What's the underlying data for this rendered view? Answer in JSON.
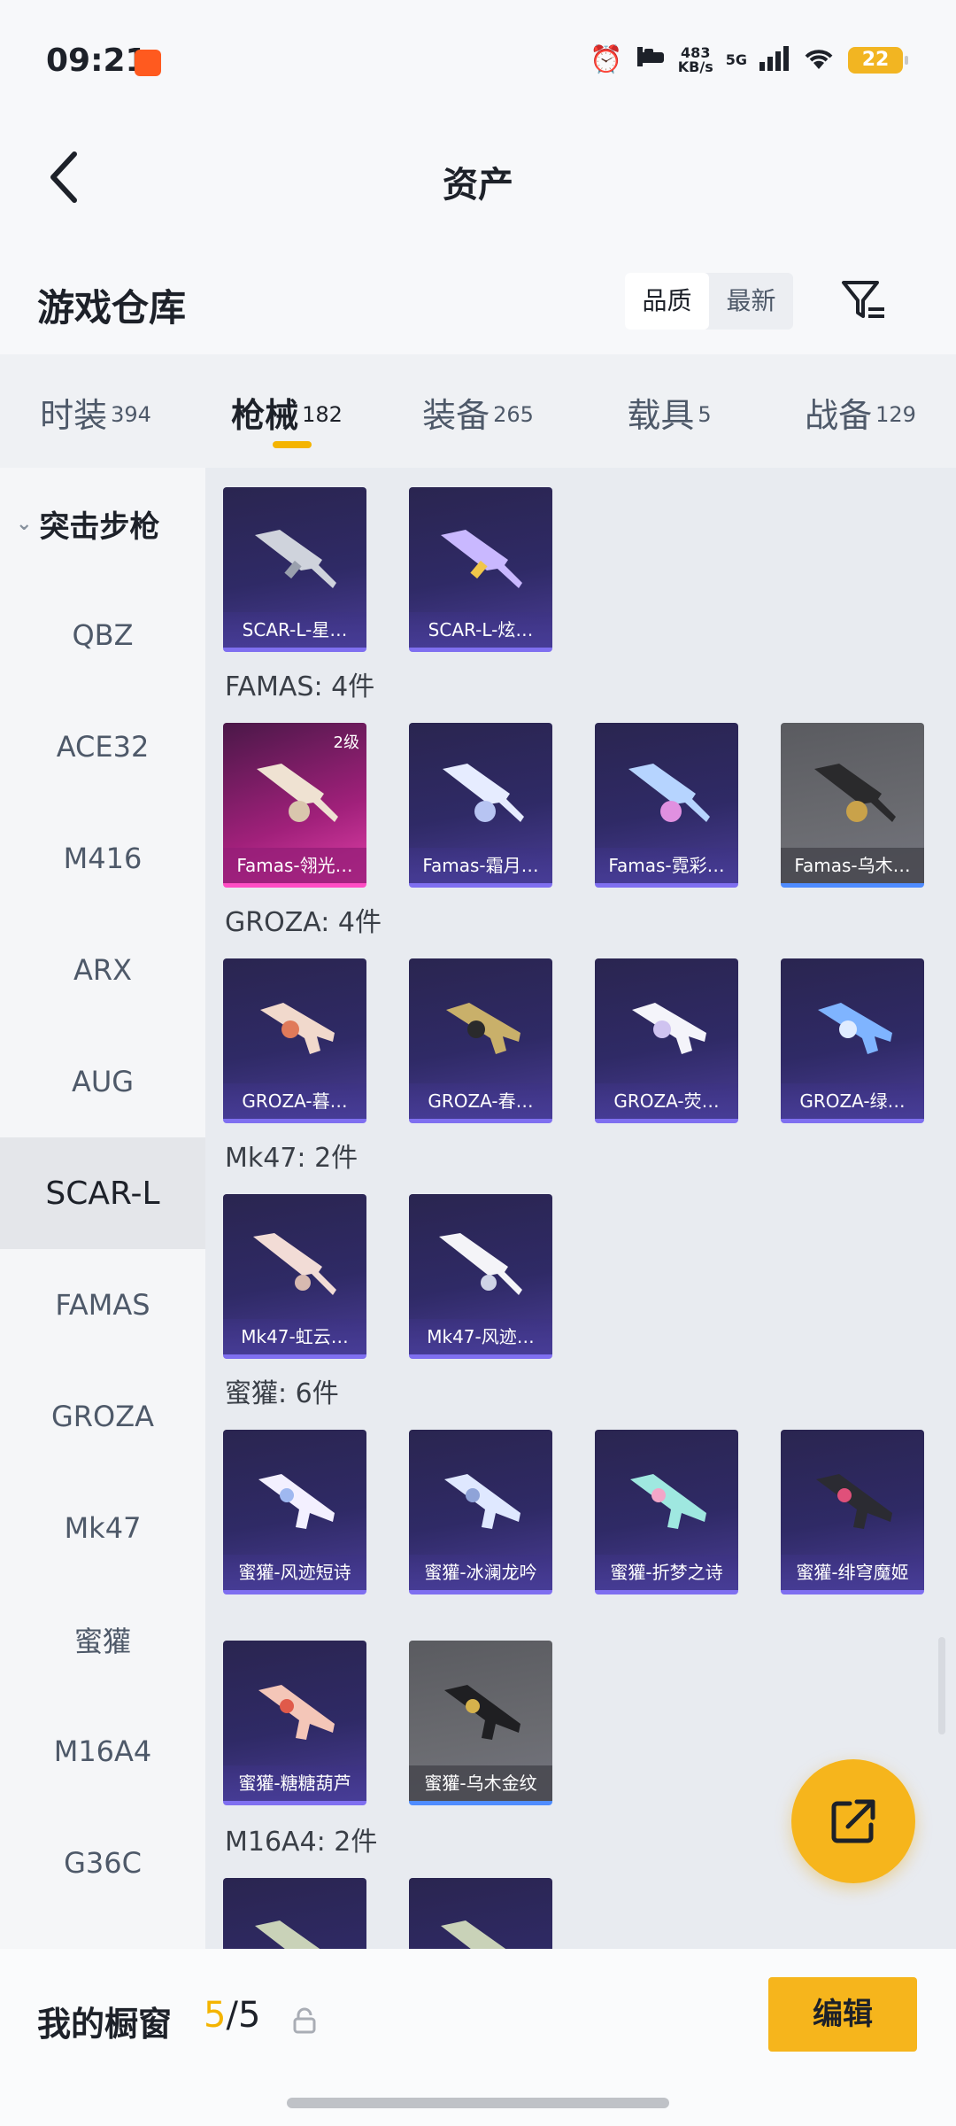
{
  "status_bar": {
    "time": "09:21",
    "speed_value": "483",
    "speed_unit": "KB/s",
    "network": "5G",
    "battery": "22"
  },
  "header": {
    "title": "资产"
  },
  "warehouse": {
    "title": "游戏仓库",
    "sort_options": [
      "品质",
      "最新"
    ],
    "sort_selected": "品质"
  },
  "tabs": [
    {
      "label": "时装",
      "count": "394"
    },
    {
      "label": "枪械",
      "count": "182",
      "active": true
    },
    {
      "label": "装备",
      "count": "265"
    },
    {
      "label": "载具",
      "count": "5"
    },
    {
      "label": "战备",
      "count": "129"
    }
  ],
  "sidebar": {
    "group": "突击步枪",
    "items": [
      "QBZ",
      "ACE32",
      "M416",
      "ARX",
      "AUG",
      "SCAR-L",
      "FAMAS",
      "GROZA",
      "Mk47",
      "蜜獾",
      "M16A4",
      "G36C"
    ],
    "active": "SCAR-L"
  },
  "sections": [
    {
      "title": "",
      "items": [
        {
          "label": "SCAR-L-星…",
          "rarity": "purple"
        },
        {
          "label": "SCAR-L-炫…",
          "rarity": "purple"
        }
      ]
    },
    {
      "title": "FAMAS: 4件",
      "items": [
        {
          "label": "Famas-翎光…",
          "rarity": "pink",
          "badge": "2级"
        },
        {
          "label": "Famas-霜月…",
          "rarity": "purple"
        },
        {
          "label": "Famas-霓彩…",
          "rarity": "purple"
        },
        {
          "label": "Famas-乌木…",
          "rarity": "gray"
        }
      ]
    },
    {
      "title": "GROZA: 4件",
      "items": [
        {
          "label": "GROZA-暮…",
          "rarity": "purple"
        },
        {
          "label": "GROZA-春…",
          "rarity": "purple"
        },
        {
          "label": "GROZA-荧…",
          "rarity": "purple"
        },
        {
          "label": "GROZA-绿…",
          "rarity": "purple"
        }
      ]
    },
    {
      "title": "Mk47: 2件",
      "items": [
        {
          "label": "Mk47-虹云…",
          "rarity": "purple"
        },
        {
          "label": "Mk47-风迹…",
          "rarity": "purple"
        }
      ]
    },
    {
      "title": "蜜獾: 6件",
      "items": [
        {
          "label": "蜜獾-风迹短诗",
          "rarity": "purple"
        },
        {
          "label": "蜜獾-冰澜龙吟",
          "rarity": "purple"
        },
        {
          "label": "蜜獾-折梦之诗",
          "rarity": "purple"
        },
        {
          "label": "蜜獾-绯穹魔姬",
          "rarity": "purple"
        },
        {
          "label": "蜜獾-糖糖葫芦",
          "rarity": "purple"
        },
        {
          "label": "蜜獾-乌木金纹",
          "rarity": "gray"
        }
      ]
    },
    {
      "title": "M16A4: 2件",
      "items": [
        {
          "label": "",
          "rarity": "purple"
        },
        {
          "label": "",
          "rarity": "purple"
        }
      ]
    }
  ],
  "showcase": {
    "label": "我的橱窗",
    "current": "5",
    "sep": "/",
    "total": "5",
    "edit_label": "编辑"
  },
  "colors": {
    "accent": "#f4b400",
    "purple_card": "#2f2a66",
    "pink_card": "#a0207a",
    "gray_card": "#6a6b70"
  }
}
